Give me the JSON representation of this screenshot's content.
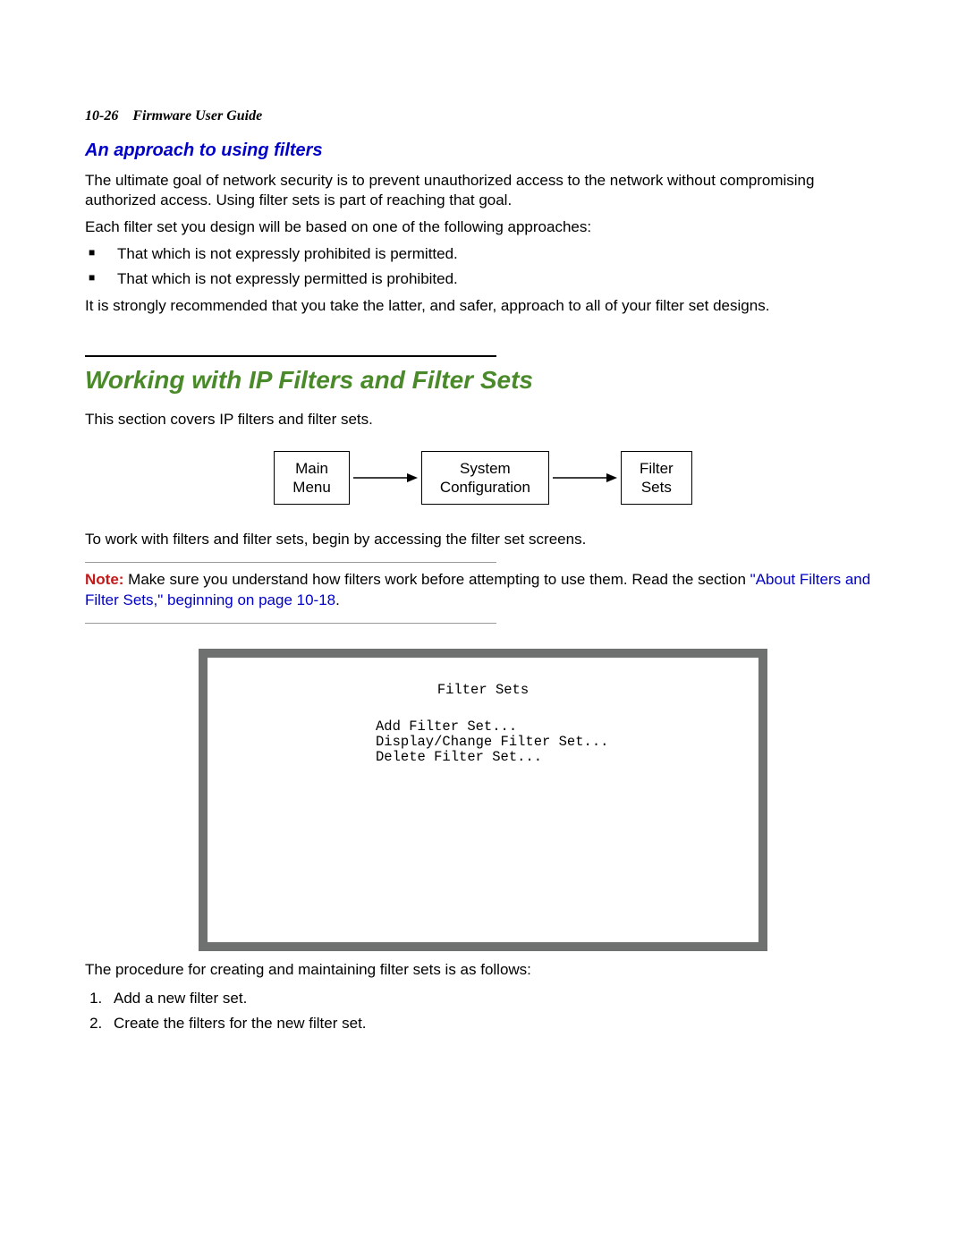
{
  "header": {
    "page_number": "10-26",
    "book_title": "Firmware User Guide"
  },
  "subheading": "An approach to using filters",
  "para1": "The ultimate goal of network security is to prevent unauthorized access to the network without compromising authorized access. Using filter sets is part of reaching that goal.",
  "para2": "Each filter set you design will be based on one of the following approaches:",
  "bullets": {
    "b1": "That which is not expressly prohibited is permitted.",
    "b2": "That which is not expressly permitted is prohibited."
  },
  "para3": "It is strongly recommended that you take the latter, and safer, approach to all of your filter set designs.",
  "section_heading": "Working with IP Filters and Filter Sets",
  "para4": "This section covers IP filters and filter sets.",
  "nav": {
    "b1_l1": "Main",
    "b1_l2": "Menu",
    "b2_l1": "System",
    "b2_l2": "Configuration",
    "b3_l1": "Filter",
    "b3_l2": "Sets"
  },
  "para5": "To work with filters and filter sets, begin by accessing the filter set screens.",
  "note": {
    "label": "Note:",
    "before_link": "  Make sure you understand how filters work before attempting to use them. Read the section ",
    "link_text": "\"About Filters and Filter Sets,\" beginning on page 10-18",
    "after_link": "."
  },
  "terminal": {
    "title": "Filter Sets",
    "line1": "Add Filter Set...",
    "line2": "Display/Change Filter Set...",
    "line3": "Delete Filter Set..."
  },
  "para6": "The procedure for creating and maintaining filter sets is as follows:",
  "steps": {
    "s1": "Add a new filter set.",
    "s2": "Create the filters for the new filter set."
  }
}
